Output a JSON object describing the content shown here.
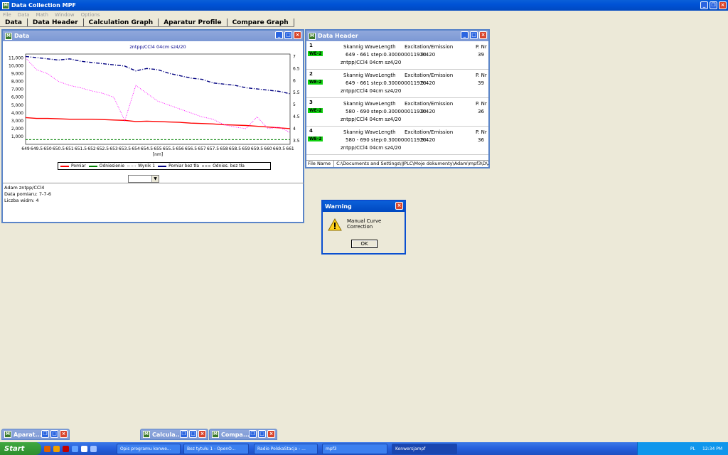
{
  "app": {
    "title": "Data Collection MPF"
  },
  "menu": [
    "File",
    "Data",
    "Math",
    "Window",
    "Options"
  ],
  "tabs": [
    "Data",
    "Data Header",
    "Calculation Graph",
    "Aparatur Profile",
    "Compare Graph"
  ],
  "data_window": {
    "title": "Data",
    "info_lines": [
      "Adam        zntpp/CCl4",
      "Data pomiaru: 7-7-6",
      "Liczba widm: 4"
    ]
  },
  "chart_data": {
    "type": "line",
    "title": "zntpp/CCl4 04cm sz4/20",
    "xlabel": "[nm]",
    "x_ticks": [
      "649",
      "649.5",
      "650",
      "650.5",
      "651",
      "651.5",
      "652",
      "652.5",
      "653",
      "653.5",
      "654",
      "654.5",
      "655",
      "655.5",
      "656",
      "656.5",
      "657",
      "657.5",
      "658",
      "658.5",
      "659",
      "659.5",
      "660",
      "660.5",
      "661"
    ],
    "y_ticks": [
      "11,000",
      "10,000",
      "9,000",
      "8,000",
      "7,000",
      "6,000",
      "5,000",
      "4,000",
      "3,000",
      "2,000",
      "1,000"
    ],
    "y2_ticks": [
      "7",
      "6.5",
      "6",
      "5.5",
      "5",
      "4.5",
      "4",
      "3.5"
    ],
    "ylim": [
      0,
      11500
    ],
    "y2lim": [
      3.35,
      7.1
    ],
    "series": [
      {
        "name": "Pomiar",
        "color": "#ff0000",
        "axis": "left",
        "values": [
          3400,
          3300,
          3300,
          3250,
          3200,
          3200,
          3200,
          3150,
          3100,
          3050,
          2900,
          2950,
          2900,
          2850,
          2800,
          2700,
          2650,
          2600,
          2500,
          2450,
          2400,
          2300,
          2200,
          2100,
          2000
        ]
      },
      {
        "name": "Odniesienie",
        "color": "#008000",
        "axis": "left",
        "values": [
          600,
          600,
          600,
          600,
          600,
          600,
          600,
          600,
          600,
          600,
          600,
          600,
          600,
          600,
          600,
          600,
          600,
          600,
          600,
          600,
          600,
          600,
          600,
          600,
          600
        ]
      },
      {
        "name": "Wynik 1",
        "color": "#808080",
        "axis": "left",
        "values": []
      },
      {
        "name": "Pomiar bez tła",
        "color": "#000080",
        "axis": "right",
        "values": [
          7.0,
          6.95,
          6.9,
          6.85,
          6.9,
          6.8,
          6.75,
          6.7,
          6.65,
          6.6,
          6.4,
          6.5,
          6.45,
          6.3,
          6.2,
          6.1,
          6.05,
          5.9,
          5.85,
          5.8,
          5.7,
          5.65,
          5.6,
          5.55,
          5.45
        ]
      },
      {
        "name": "Odnies. bez tła",
        "color": "#ff00ff",
        "axis": "left",
        "values": [
          11000,
          9500,
          9000,
          8000,
          7500,
          7200,
          6800,
          6500,
          6000,
          3000,
          7500,
          6500,
          5500,
          5000,
          4500,
          4000,
          3500,
          3200,
          2500,
          2200,
          2000,
          3500,
          2000,
          2200,
          1500
        ]
      }
    ]
  },
  "header_window": {
    "title": "Data Header",
    "col_skan": "Skannig WaveLength",
    "col_exc": "Excitation/Emission",
    "col_p": "P. Nr",
    "rows": [
      {
        "num": "1",
        "badge": "WE-2",
        "range": "649 - 661 step:0.300000011920",
        "exc": "9:420",
        "p": "39",
        "name": "zntpp/CCl4 04cm sz4/20"
      },
      {
        "num": "2",
        "badge": "WE-2",
        "range": "649 - 661 step:0.300000011920",
        "exc": "9:420",
        "p": "39",
        "name": "zntpp/CCl4 04cm sz4/20"
      },
      {
        "num": "3",
        "badge": "WE-2",
        "range": "580 - 690 step:0.300000011920",
        "exc": "9:420",
        "p": "36",
        "name": "zntpp/CCl4 04cm sz4/20"
      },
      {
        "num": "4",
        "badge": "WE-2",
        "range": "580 - 690 step:0.300000011920",
        "exc": "9:420",
        "p": "36",
        "name": "zntpp/CCl4 04cm sz4/20"
      }
    ],
    "file_label": "File Name",
    "file_path": "C:\\Documents and Settings\\IJPLC\\Moje dokumenty\\Adam\\mpf3\\D\\Zntp"
  },
  "dialog": {
    "title": "Warning",
    "message": "Manual Curve Correction",
    "ok": "OK"
  },
  "minimized": [
    "Aparat...",
    "Calcula...",
    "Compa..."
  ],
  "taskbar": {
    "start": "Start",
    "tasks": [
      "Opis programu konwe...",
      "Bez tytułu 1 - OpenO...",
      "Radio PolskaStacja - ...",
      "mpf3",
      "Konwersjampf"
    ],
    "lang": "PL",
    "time": "12:34 PM"
  }
}
